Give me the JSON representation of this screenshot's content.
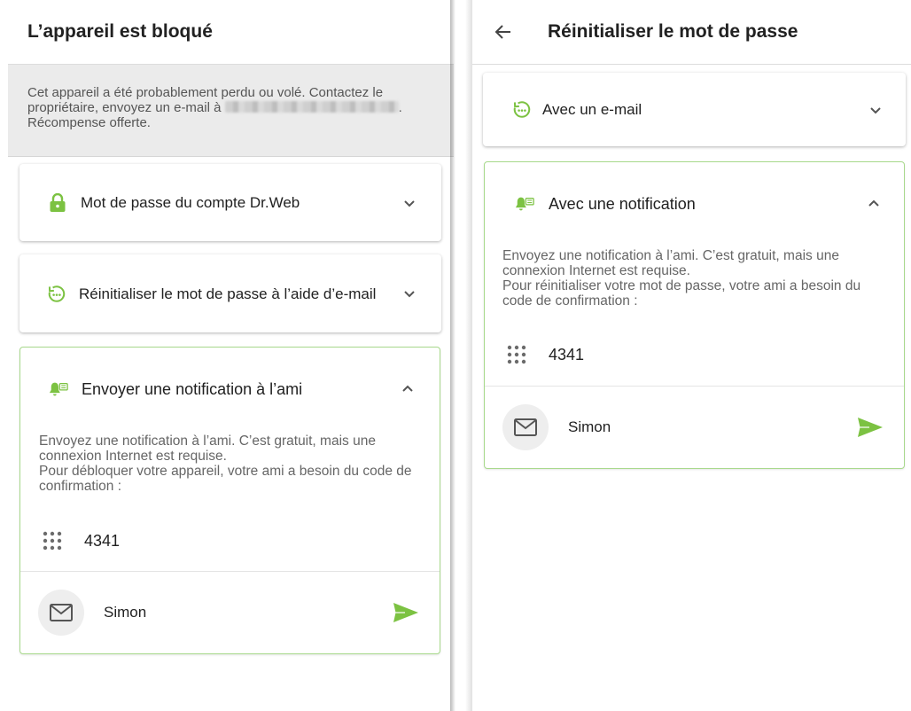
{
  "left": {
    "title": "L’appareil est bloqué",
    "banner": {
      "text_before": "Cet appareil a été probablement perdu ou volé. Contactez le propriétaire, envoyez un e-mail à ",
      "text_after": ". Récompense offerte."
    },
    "cards": [
      {
        "title": "Mot de passe du compte Dr.Web",
        "icon": "lock-icon",
        "state": "collapsed"
      },
      {
        "title": "Réinitialiser le mot de passe à l’aide d’e-mail",
        "icon": "email-reset-icon",
        "state": "collapsed"
      },
      {
        "title": "Envoyer une notification à l’ami",
        "icon": "notification-icon",
        "state": "expanded"
      }
    ],
    "notification": {
      "description": "Envoyez une notification à l’ami. C’est gratuit, mais une connexion Internet est requise.",
      "instruction": "Pour débloquer votre appareil, votre ami a besoin du code de confirmation :",
      "code": "4341",
      "friend_name": "Simon"
    }
  },
  "right": {
    "title": "Réinitialiser le mot de passe",
    "cards": [
      {
        "title": "Avec un e-mail",
        "icon": "email-reset-icon",
        "state": "collapsed"
      },
      {
        "title": "Avec une notification",
        "icon": "notification-icon",
        "state": "expanded"
      }
    ],
    "notification": {
      "description": "Envoyez une notification à l’ami. C’est gratuit, mais une connexion Internet est requise.",
      "instruction": "Pour réinitialiser votre mot de passe, votre ami a besoin du code de confirmation :",
      "code": "4341",
      "friend_name": "Simon"
    }
  },
  "colors": {
    "accent_green": "#7cc242",
    "expanded_border": "#a8d98c",
    "banner_bg": "#ebebeb"
  }
}
